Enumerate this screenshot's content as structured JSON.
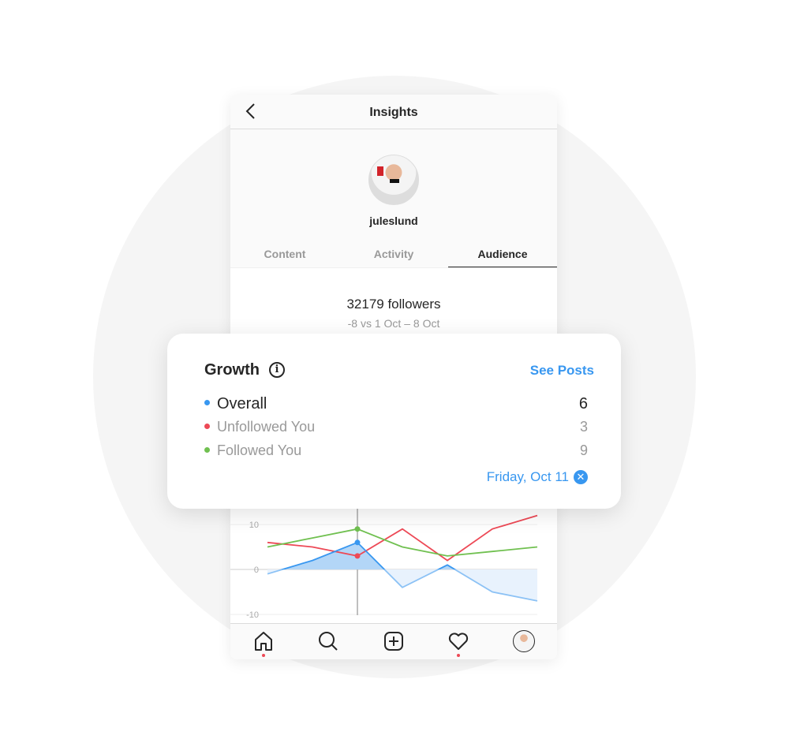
{
  "header": {
    "title": "Insights"
  },
  "profile": {
    "username": "juleslund"
  },
  "tabs": [
    {
      "label": "Content"
    },
    {
      "label": "Activity"
    },
    {
      "label": "Audience",
      "active": true
    }
  ],
  "followers": {
    "count": "32179 followers",
    "comparison": "-8 vs 1 Oct – 8 Oct"
  },
  "growth_card": {
    "title": "Growth",
    "see_posts": "See Posts",
    "rows": [
      {
        "label": "Overall",
        "value": "6",
        "color": "#3897f0"
      },
      {
        "label": "Unfollowed You",
        "value": "3",
        "color": "#ed4956"
      },
      {
        "label": "Followed You",
        "value": "9",
        "color": "#70c050"
      }
    ],
    "selected_date": "Friday, Oct 11"
  },
  "chart_data": {
    "type": "line",
    "ylim": [
      -10,
      12
    ],
    "yticks": [
      "10",
      "0",
      "-10"
    ],
    "grid": true,
    "selected_index": 2,
    "series": [
      {
        "name": "Overall",
        "color": "#3897f0",
        "values": [
          -1,
          2,
          6,
          -4,
          1,
          -5,
          -7
        ]
      },
      {
        "name": "Unfollowed You",
        "color": "#ed4956",
        "values": [
          6,
          5,
          3,
          9,
          2,
          9,
          12
        ]
      },
      {
        "name": "Followed You",
        "color": "#70c050",
        "values": [
          5,
          7,
          9,
          5,
          3,
          4,
          5
        ]
      }
    ]
  },
  "nav": {
    "items": [
      "home",
      "search",
      "new-post",
      "activity",
      "profile"
    ]
  }
}
